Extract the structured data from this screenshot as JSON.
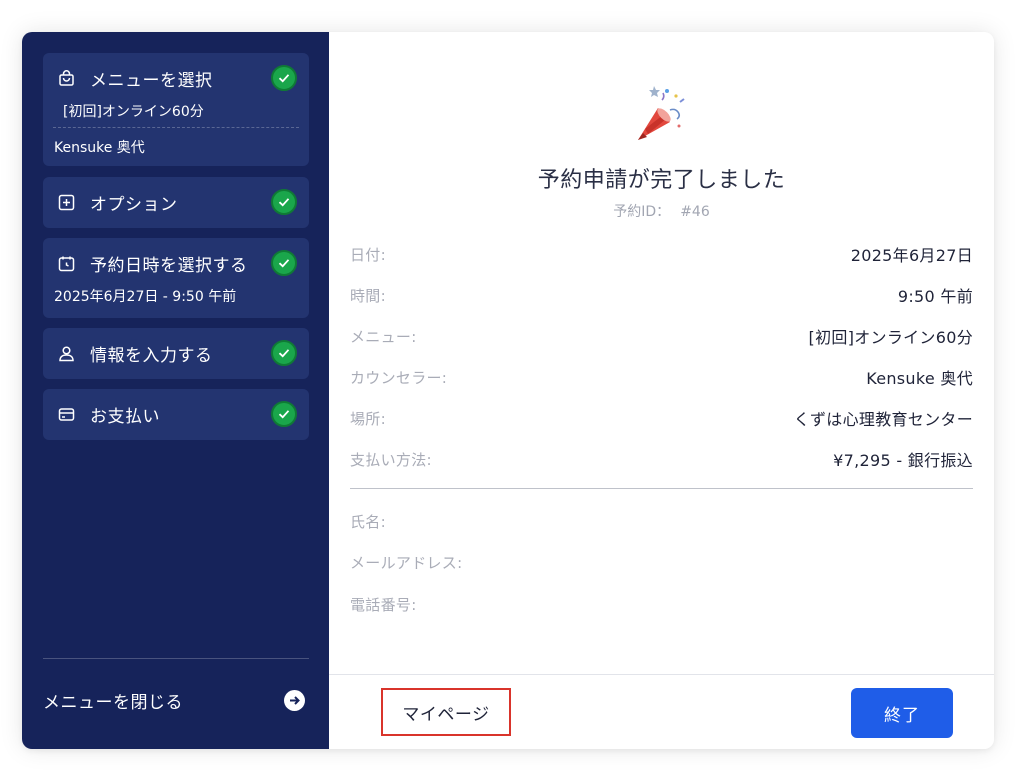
{
  "sidebar": {
    "steps": [
      {
        "label": "メニューを選択",
        "icon": "shopping-bag-icon",
        "sub": "[初回]オンライン60分",
        "sub2": "Kensuke 奥代",
        "completed": true
      },
      {
        "label": "オプション",
        "icon": "plus-square-icon",
        "completed": true
      },
      {
        "label": "予約日時を選択する",
        "icon": "calendar-clock-icon",
        "sub": "2025年6月27日 - 9:50 午前",
        "completed": true
      },
      {
        "label": "情報を入力する",
        "icon": "user-icon",
        "completed": true
      },
      {
        "label": "お支払い",
        "icon": "credit-card-icon",
        "completed": true
      }
    ],
    "close_menu_label": "メニューを閉じる",
    "close_menu_icon": "arrow-right-circle-icon"
  },
  "main": {
    "celebration_icon": "party-popper-icon",
    "title": "予約申請が完了しました",
    "reservation_id_label": "予約ID：",
    "reservation_id_value": "#46",
    "details": [
      {
        "label": "日付:",
        "value": "2025年6月27日"
      },
      {
        "label": "時間:",
        "value": "9:50 午前"
      },
      {
        "label": "メニュー:",
        "value": "[初回]オンライン60分"
      },
      {
        "label": "カウンセラー:",
        "value": "Kensuke 奥代"
      },
      {
        "label": "場所:",
        "value": "くずは心理教育センター"
      },
      {
        "label": "支払い方法:",
        "value": "¥7,295 - 銀行振込"
      }
    ],
    "personal": [
      {
        "label": "氏名:",
        "value": ""
      },
      {
        "label": "メールアドレス:",
        "value": ""
      },
      {
        "label": "電話番号:",
        "value": ""
      }
    ],
    "mypage_button": "マイページ",
    "end_button": "終了"
  },
  "colors": {
    "sidebar_bg": "#16235a",
    "card_bg": "#233470",
    "check_green": "#1aa64b",
    "primary_blue": "#1f5de8",
    "highlight_red": "#d9342b"
  }
}
